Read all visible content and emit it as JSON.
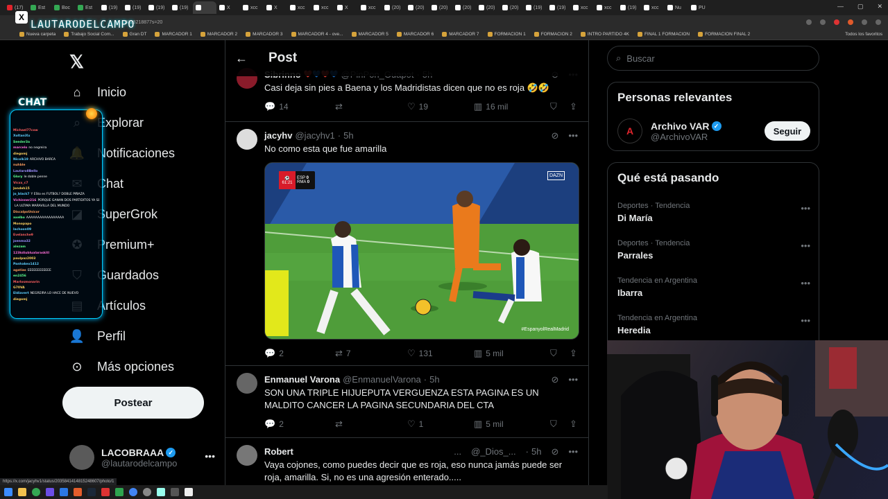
{
  "browser": {
    "tabs": [
      {
        "label": "(17)",
        "color": "#e0242c"
      },
      {
        "label": "Est",
        "color": "#34a853"
      },
      {
        "label": "Boc",
        "color": "#34a853"
      },
      {
        "label": "Est",
        "color": "#34a853"
      },
      {
        "label": "(19)",
        "color": "#ffffff"
      },
      {
        "label": "(19)",
        "color": "#ffffff"
      },
      {
        "label": "(19)",
        "color": "#ffffff"
      },
      {
        "label": "(19)",
        "color": "#ffffff"
      },
      {
        "label": "",
        "color": "#ffffff",
        "active": true
      },
      {
        "label": "X",
        "color": "#ffffff"
      },
      {
        "label": "xcc",
        "color": "#ffffff"
      },
      {
        "label": "X",
        "color": "#ffffff"
      },
      {
        "label": "xcc",
        "color": "#ffffff"
      },
      {
        "label": "xcc",
        "color": "#ffffff"
      },
      {
        "label": "X",
        "color": "#ffffff"
      },
      {
        "label": "xcc",
        "color": "#ffffff"
      },
      {
        "label": "(20)",
        "color": "#ffffff"
      },
      {
        "label": "(20)",
        "color": "#ffffff"
      },
      {
        "label": "(20)",
        "color": "#ffffff"
      },
      {
        "label": "(20)",
        "color": "#ffffff"
      },
      {
        "label": "(20)",
        "color": "#ffffff"
      },
      {
        "label": "(20)",
        "color": "#ffffff"
      },
      {
        "label": "(19)",
        "color": "#ffffff"
      },
      {
        "label": "(19)",
        "color": "#ffffff"
      },
      {
        "label": "xcc",
        "color": "#ffffff"
      },
      {
        "label": "xcc",
        "color": "#ffffff"
      },
      {
        "label": "(19)",
        "color": "#ffffff"
      },
      {
        "label": "xcc",
        "color": "#ffffff"
      },
      {
        "label": "Nu",
        "color": "#ffffff"
      },
      {
        "label": "PU",
        "color": "#ffffff"
      }
    ],
    "url": "3828218877s=20",
    "bookmarks": [
      "Nueva carpeta",
      "Trabajo Social Com...",
      "Gran DT",
      "MARCADOR 1",
      "MARCADOR 2",
      "MARCADOR 3",
      "MARCADOR 4 - ove...",
      "MARCADOR 5",
      "MARCADOR 6",
      "MARCADOR 7",
      "FORMACION 1",
      "FORMACION 2",
      "INTRO PARTIDO 4K",
      "FINAL 1 FORMACION",
      "FORMACION FINAL 2"
    ],
    "bookmarks_right": "Todos los favoritos",
    "status_url": "https://x.com/jacyhv1/status/2035841414815248607/photo/1"
  },
  "overlay": {
    "streamer_name": "LAUTARODELCAMPO",
    "chat_title": "CHAT",
    "chat_lines": [
      {
        "user": "Michael77cow",
        "msg": "",
        "color": "#ff5f5f"
      },
      {
        "user": "XoltaniXx",
        "msg": "",
        "color": "#5fd0ff"
      },
      {
        "user": "Seeder3a",
        "msg": "",
        "color": "#5fff8f"
      },
      {
        "user": "marcelo",
        "msg": "no negreira",
        "color": "#ff6fd8"
      },
      {
        "user": "diegomj",
        "msg": "",
        "color": "#ffd15f"
      },
      {
        "user": "Nicolk19",
        "msg": "ARCHIVO BARCA",
        "color": "#5fd0ff"
      },
      {
        "user": "nuhble",
        "msg": "",
        "color": "#ff9f5f"
      },
      {
        "user": "Lautaro8Bello",
        "msg": "",
        "color": "#9f8fff"
      },
      {
        "user": "Glory",
        "msg": "le doble penne",
        "color": "#5fff8f"
      },
      {
        "user": "Vicxx_c7",
        "msg": "",
        "color": "#ff5f5f"
      },
      {
        "user": "Jondeh15",
        "msg": "",
        "color": "#ffd15f"
      },
      {
        "user": "jo_black7",
        "msg": "Y ESto es FUTBOL? DOBLE PIÑAZA",
        "color": "#5fd0ff"
      },
      {
        "user": "Vichinner216",
        "msg": "PORQUE GANAN DOS PARTIDITOS YA SE CREEN",
        "color": "#ff6fd8"
      },
      {
        "user": "",
        "msg": "LA ULTIMA MARAVILLA DEL MUNDO",
        "color": "#ffffff"
      },
      {
        "user": "DiscalpoUnicor",
        "msg": "",
        "color": "#ff9f5f"
      },
      {
        "user": "axelbo",
        "msg": "AAAAAAAAAAAAAAAAA",
        "color": "#5fff8f"
      },
      {
        "user": "Monopapo",
        "msg": "",
        "color": "#ffd15f"
      },
      {
        "user": "lachoon09",
        "msg": "",
        "color": "#5fd0ff"
      },
      {
        "user": "Evelanche9",
        "msg": "",
        "color": "#ff5f5f"
      },
      {
        "user": "joenma32",
        "msg": "",
        "color": "#9f8fff"
      },
      {
        "user": "alezam",
        "msg": "",
        "color": "#5fff8f"
      },
      {
        "user": "123kdiublualaraskitl",
        "msg": "",
        "color": "#ff6fd8"
      },
      {
        "user": "paulpaz2003",
        "msg": "",
        "color": "#ffd15f"
      },
      {
        "user": "Panhakex1412",
        "msg": "",
        "color": "#5fd0ff"
      },
      {
        "user": "agatias",
        "msg": "EEEEEEEEEEEE",
        "color": "#ff9f5f"
      },
      {
        "user": "en2456",
        "msg": "",
        "color": "#5fff8f"
      },
      {
        "user": "Marlosmonarin",
        "msg": "",
        "color": "#ff5f5f"
      },
      {
        "user": "G70VA",
        "msg": "",
        "color": "#ffd15f"
      },
      {
        "user": "Eldiavert",
        "msg": "NEGREIRA LO HACE DE NUEVO",
        "color": "#5fd0ff"
      },
      {
        "user": "diegomj",
        "msg": "",
        "color": "#ffd15f"
      }
    ]
  },
  "nav": {
    "items": [
      {
        "label": "Inicio",
        "icon": "home-icon"
      },
      {
        "label": "Explorar",
        "icon": "search-icon"
      },
      {
        "label": "Notificaciones",
        "icon": "bell-icon",
        "badge": "10"
      },
      {
        "label": "Chat",
        "icon": "mail-icon"
      },
      {
        "label": "SuperGrok",
        "icon": "grok-icon"
      },
      {
        "label": "Premium+",
        "icon": "premium-icon"
      },
      {
        "label": "Guardados",
        "icon": "bookmark-icon"
      },
      {
        "label": "Artículos",
        "icon": "articles-icon"
      },
      {
        "label": "Perfil",
        "icon": "person-icon"
      },
      {
        "label": "Más opciones",
        "icon": "more-circle-icon"
      }
    ],
    "post_button": "Postear",
    "account": {
      "name": "LACOBRAAA",
      "handle": "@lautarodelcampo"
    }
  },
  "center": {
    "title": "Post",
    "tweets": [
      {
        "name": "Sibrinno",
        "emojis": "❤️💙❤️💙",
        "handle": "@PinPon_Guapot",
        "time": "5h",
        "text": "Casi deja sin pies a Baena y los Madridistas dicen que no es roja 🤣🤣",
        "replies": "14",
        "retweets": "",
        "likes": "19",
        "views": "16 mil"
      },
      {
        "name": "jacyhv",
        "handle": "@jacyhv1",
        "time": "5h",
        "text": "No como esta que fue amarilla",
        "replies": "2",
        "retweets": "7",
        "likes": "131",
        "views": "5 mil",
        "media": {
          "clock": "61:21",
          "home_score": "0",
          "away_score": "0",
          "home_abbr": "ESP",
          "away_abbr": "RMA",
          "broadcaster": "DAZN",
          "hashtag": "#EspanyolRealMadrid"
        }
      },
      {
        "name": "Enmanuel Varona",
        "handle": "@EnmanuelVarona",
        "time": "5h",
        "text": "SON UNA TRIPLE HIJUEPUTA VERGUENZA ESTA PAGINA ES UN MALDITO CANCER LA PAGINA SECUNDARIA DEL CTA",
        "replies": "2",
        "retweets": "",
        "likes": "1",
        "views": "5 mil"
      },
      {
        "name": "Robert",
        "handle": "@_Dios_...",
        "time": "5h",
        "text": "Vaya cojones, como puedes decir que es roja, eso nunca jamás puede ser roja, amarilla. Si, no es una agresión enterado....."
      }
    ]
  },
  "sidebar": {
    "search_placeholder": "Buscar",
    "relevant_title": "Personas relevantes",
    "person": {
      "name": "Archivo VAR",
      "handle": "@ArchivoVAR",
      "follow": "Seguir"
    },
    "trending_title": "Qué está pasando",
    "trends": [
      {
        "category": "Deportes · Tendencia",
        "topic": "Di María"
      },
      {
        "category": "Deportes · Tendencia",
        "topic": "Parrales"
      },
      {
        "category": "Tendencia en Argentina",
        "topic": "Ibarra"
      },
      {
        "category": "Tendencia en Argentina",
        "topic": "Heredia"
      }
    ]
  }
}
